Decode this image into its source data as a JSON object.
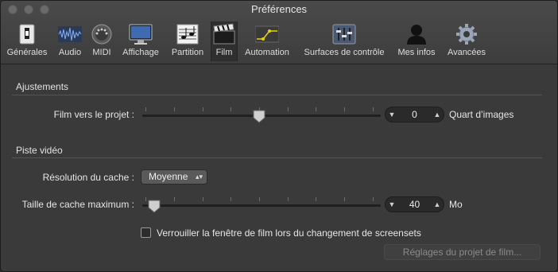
{
  "window": {
    "title": "Préférences"
  },
  "toolbar": {
    "items": [
      {
        "label": "Générales",
        "icon": "switch-icon"
      },
      {
        "label": "Audio",
        "icon": "audio-waveform-icon"
      },
      {
        "label": "MIDI",
        "icon": "midi-connector-icon"
      },
      {
        "label": "Affichage",
        "icon": "monitor-icon"
      },
      {
        "label": "Partition",
        "icon": "music-score-icon"
      },
      {
        "label": "Film",
        "icon": "clapperboard-icon"
      },
      {
        "label": "Automation",
        "icon": "automation-curve-icon"
      },
      {
        "label": "Surfaces de contrôle",
        "icon": "fader-control-icon"
      },
      {
        "label": "Mes infos",
        "icon": "user-silhouette-icon"
      },
      {
        "label": "Avancées",
        "icon": "gear-icon"
      }
    ],
    "selected": "Film"
  },
  "ajustements": {
    "section_title": "Ajustements",
    "film_label": "Film vers le projet :",
    "film_value": "0",
    "film_unit": "Quart d’images"
  },
  "piste": {
    "section_title": "Piste vidéo",
    "resolution_label": "Résolution du cache :",
    "resolution_value": "Moyenne",
    "taille_label": "Taille de cache maximum :",
    "taille_value": "40",
    "taille_unit": "Mo",
    "lock_label": "Verrouiller la fenêtre de film lors du changement de screensets",
    "lock_checked": false,
    "settings_button": "Réglages du projet de film..."
  }
}
